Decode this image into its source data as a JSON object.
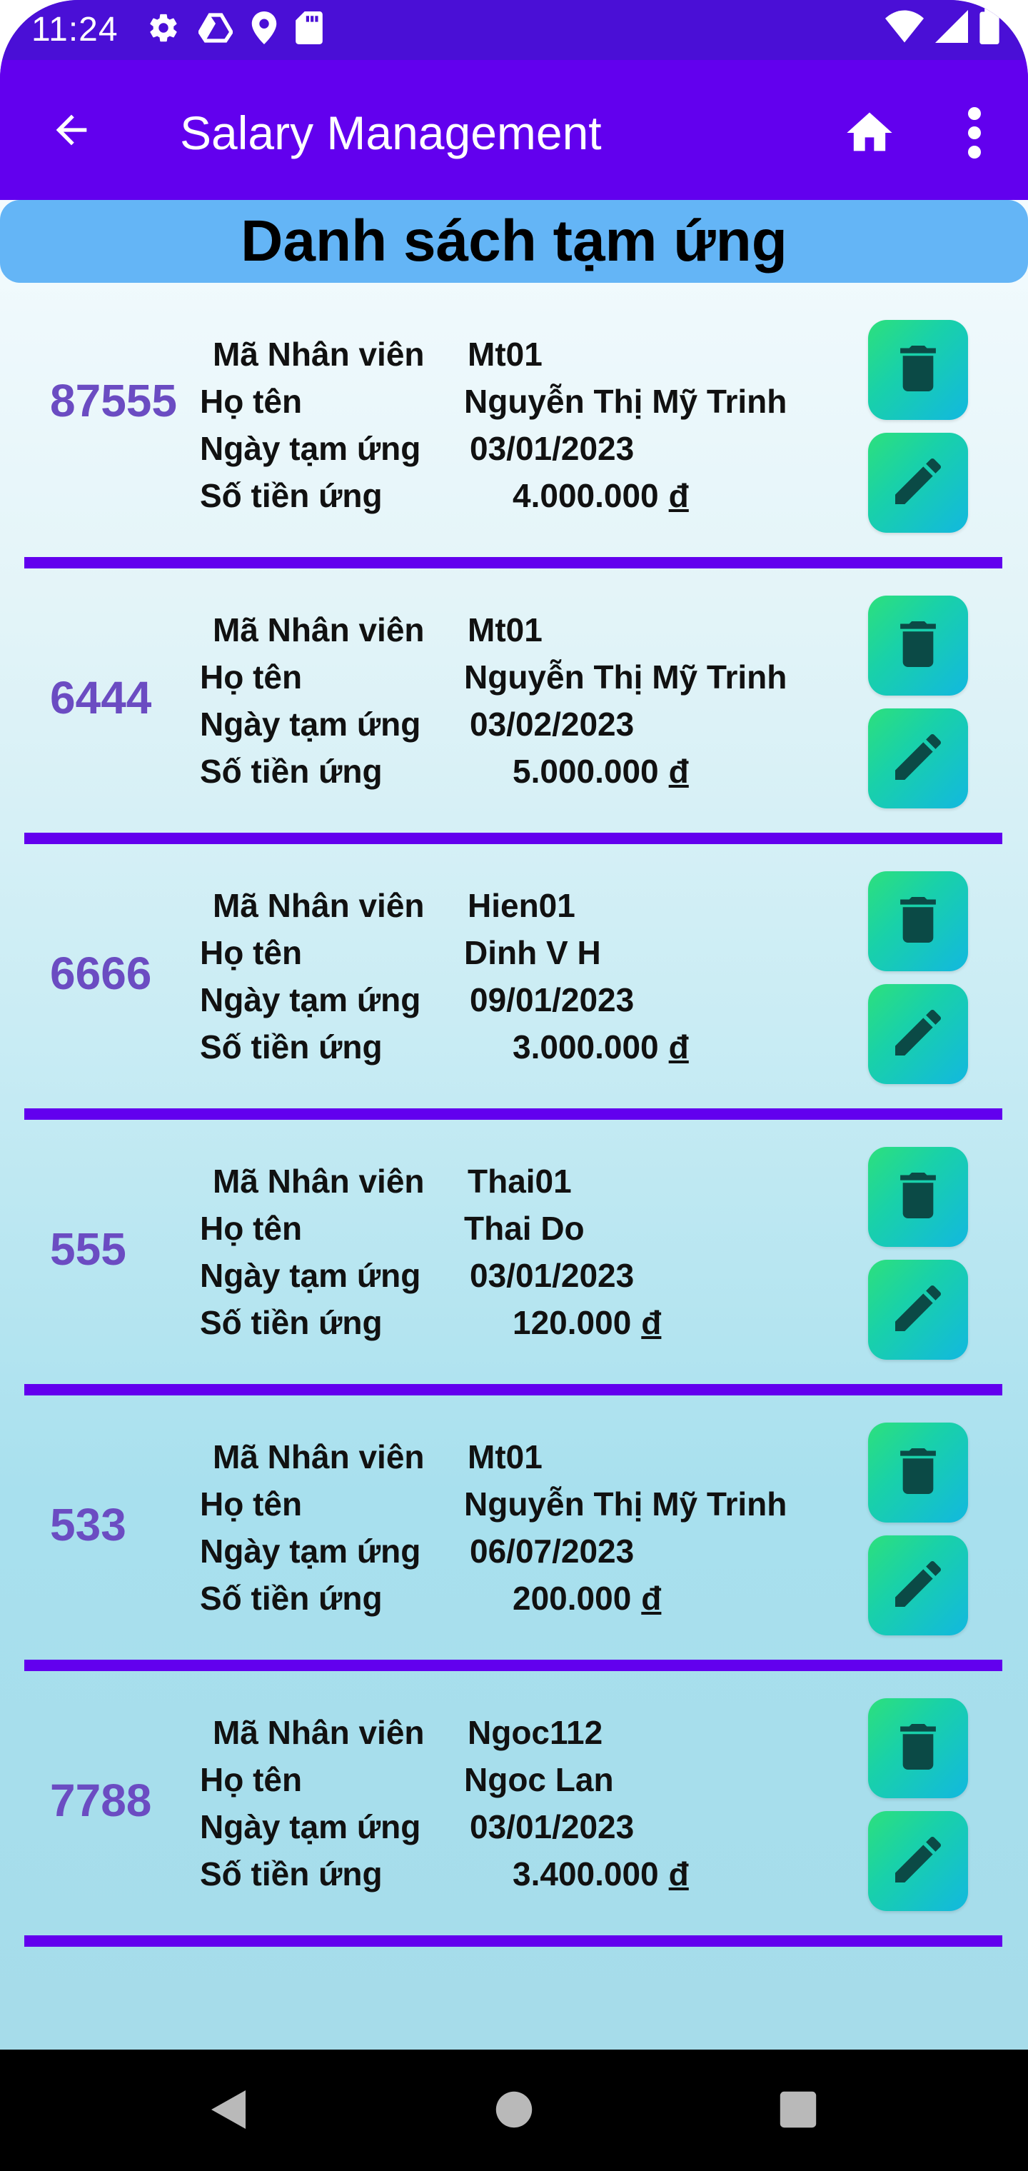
{
  "status_bar": {
    "time": "11:24",
    "left_icons": [
      "settings-icon",
      "drive-icon",
      "location-icon",
      "sd-card-icon"
    ],
    "right_icons": [
      "wifi-icon",
      "signal-icon",
      "battery-icon"
    ]
  },
  "app_bar": {
    "title": "Salary Management",
    "background": "#6200ee"
  },
  "header": {
    "title": "Danh sách tạm ứng",
    "background": "#64b5f6"
  },
  "labels": {
    "employee_id": "Mã Nhân viên",
    "full_name": "Họ tên",
    "advance_date": "Ngày tạm ứng",
    "amount": "Số tiền ứng",
    "currency": "đ"
  },
  "items": [
    {
      "id": "87555",
      "employee_id": "Mt01",
      "name": "Nguyễn Thị Mỹ Trinh",
      "date": "03/01/2023",
      "amount": "4.000.000"
    },
    {
      "id": "6444",
      "employee_id": "Mt01",
      "name": "Nguyễn Thị Mỹ Trinh",
      "date": "03/02/2023",
      "amount": "5.000.000"
    },
    {
      "id": "6666",
      "employee_id": "Hien01",
      "name": "Dinh V H",
      "date": "09/01/2023",
      "amount": "3.000.000"
    },
    {
      "id": "555",
      "employee_id": "Thai01",
      "name": "Thai Do",
      "date": "03/01/2023",
      "amount": "120.000"
    },
    {
      "id": "533",
      "employee_id": "Mt01",
      "name": "Nguyễn Thị Mỹ Trinh",
      "date": "06/07/2023",
      "amount": "200.000"
    },
    {
      "id": "7788",
      "employee_id": "Ngoc112",
      "name": "Ngoc Lan",
      "date": "03/01/2023",
      "amount": "3.400.000"
    }
  ],
  "colors": {
    "accent": "#6200ee",
    "id_text": "#6b4cc2",
    "action_gradient_start": "#2de07c",
    "action_gradient_end": "#12b8df"
  }
}
